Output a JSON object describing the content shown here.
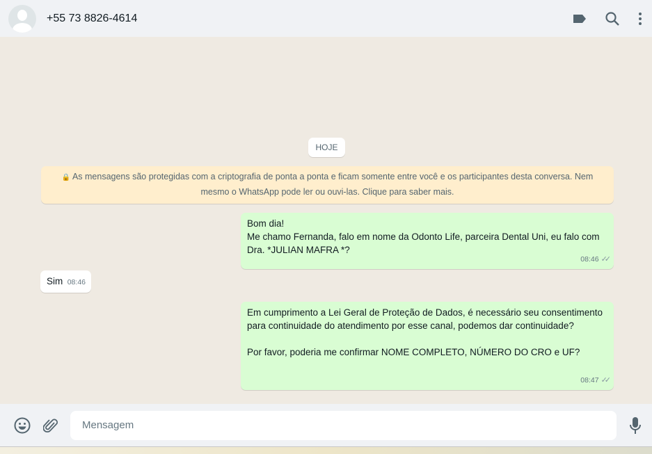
{
  "header": {
    "contact": "+55 73 8826-4614",
    "icons": [
      "label-icon",
      "search-icon",
      "menu-icon"
    ]
  },
  "chat": {
    "date_chip": "HOJE",
    "encryption_notice": "As mensagens são protegidas com a criptografia de ponta a ponta e ficam somente entre você e os participantes desta conversa. Nem mesmo o WhatsApp pode ler ou ouvi-las. Clique para saber mais.",
    "messages": [
      {
        "direction": "out",
        "lines": [
          "Bom dia!",
          "Me chamo Fernanda, falo em nome da Odonto Life, parceira Dental Uni, eu falo com Dra. *JULIAN MAFRA *?"
        ],
        "time": "08:46",
        "status": "read"
      },
      {
        "direction": "in",
        "text": "Sim",
        "time": "08:46"
      },
      {
        "direction": "out",
        "lines": [
          "Em cumprimento a Lei Geral de Proteção de Dados, é necessário seu consentimento para continuidade do atendimento por esse canal, podemos dar continuidade?",
          "",
          "Por favor, poderia me confirmar NOME COMPLETO, NÚMERO DO CRO e UF?"
        ],
        "time": "08:47",
        "status": "read"
      }
    ]
  },
  "composer": {
    "placeholder": "Mensagem"
  },
  "colors": {
    "outgoing": "#d9fdd3",
    "incoming": "#ffffff",
    "background": "#efeae2",
    "notice": "#ffeecd"
  }
}
